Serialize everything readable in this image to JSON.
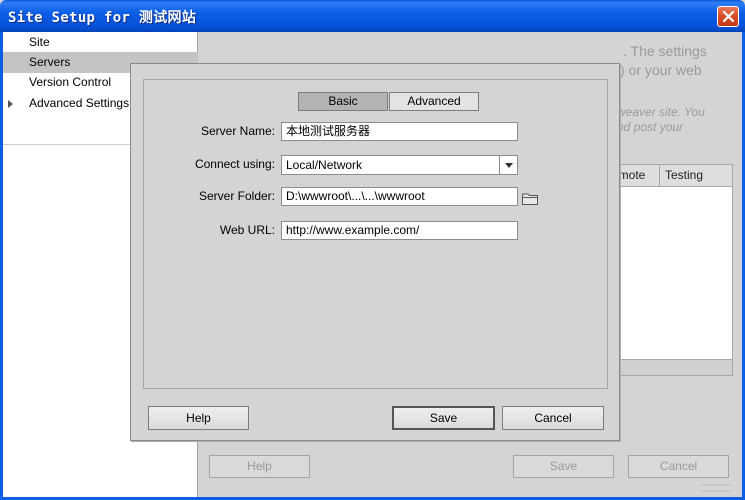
{
  "window": {
    "title": "Site Setup for 测试网站"
  },
  "sidebar": {
    "items": [
      {
        "label": "Site"
      },
      {
        "label": "Servers"
      },
      {
        "label": "Version Control"
      },
      {
        "label": "Advanced Settings"
      }
    ]
  },
  "background": {
    "line1": ". The settings",
    "line2": ") or your web",
    "line3": "weaver site. You",
    "line4": "nd post your",
    "table_headers": [
      "emote",
      "Testing"
    ],
    "help_label": "Help",
    "save_label": "Save",
    "cancel_label": "Cancel"
  },
  "dialog": {
    "tabs": [
      {
        "label": "Basic"
      },
      {
        "label": "Advanced"
      }
    ],
    "server_name_label": "Server Name:",
    "server_name_value": "本地测试服务器",
    "connect_label": "Connect using:",
    "connect_value": "Local/Network",
    "folder_label": "Server Folder:",
    "folder_value": "D:\\wwwroot\\...\\...\\wwwroot",
    "url_label": "Web URL:",
    "url_value": "http://www.example.com/",
    "help_label": "Help",
    "save_label": "Save",
    "cancel_label": "Cancel"
  },
  "colors": {
    "titlebar": "#0b5ee6",
    "selection": "#c4c4c4"
  },
  "icons": [
    "close-icon",
    "expand-arrow-icon",
    "dropdown-arrow-icon",
    "folder-icon"
  ]
}
